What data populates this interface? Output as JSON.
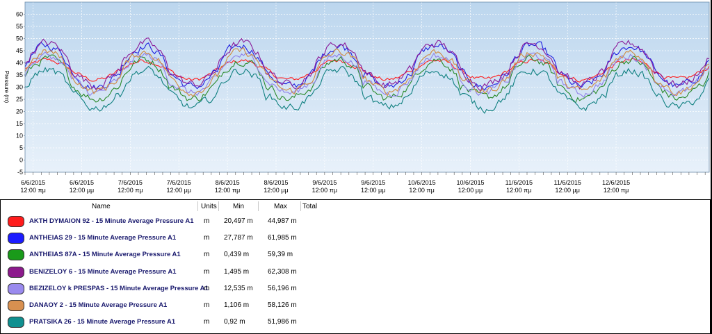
{
  "chart_data": {
    "type": "line",
    "ylabel": "Pressure (m)",
    "ylim": [
      -5,
      65
    ],
    "yticks": [
      -5,
      0,
      5,
      10,
      15,
      20,
      25,
      30,
      35,
      40,
      45,
      50,
      55,
      60
    ],
    "x_range": [
      "2015-06-05 22:00",
      "2015-06-12 23:00"
    ],
    "xtick_labels": [
      {
        "date": "6/6/2015",
        "time": "12:00 πμ"
      },
      {
        "date": "6/6/2015",
        "time": "12:00 μμ"
      },
      {
        "date": "7/6/2015",
        "time": "12:00 πμ"
      },
      {
        "date": "7/6/2015",
        "time": "12:00 μμ"
      },
      {
        "date": "8/6/2015",
        "time": "12:00 πμ"
      },
      {
        "date": "8/6/2015",
        "time": "12:00 μμ"
      },
      {
        "date": "9/6/2015",
        "time": "12:00 πμ"
      },
      {
        "date": "9/6/2015",
        "time": "12:00 μμ"
      },
      {
        "date": "10/6/2015",
        "time": "12:00 πμ"
      },
      {
        "date": "10/6/2015",
        "time": "12:00 μμ"
      },
      {
        "date": "11/6/2015",
        "time": "12:00 πμ"
      },
      {
        "date": "11/6/2015",
        "time": "12:00 μμ"
      },
      {
        "date": "12/6/2015",
        "time": "12:00 πμ"
      }
    ],
    "grid": true,
    "series": [
      {
        "name": "AKTH DYMAION 92 - 15 Minute Average Pressure A1",
        "color": "#ff2020",
        "base": 36,
        "amp": 5,
        "noise": 1.0
      },
      {
        "name": "ANTHEIAS 29 - 15 Minute Average Pressure A1",
        "color": "#2020e0",
        "base": 36,
        "amp": 22,
        "noise": 1.5
      },
      {
        "name": "ANTHEIAS 87A - 15 Minute Average Pressure A1",
        "color": "#2a8a2a",
        "base": 31,
        "amp": 21,
        "noise": 1.5
      },
      {
        "name": "BENIZELOY 6 - 15 Minute Average Pressure A1",
        "color": "#8a1a9a",
        "base": 37,
        "amp": 22,
        "noise": 1.5
      },
      {
        "name": "BEZIZELOY k PRESPAS - 15 Minute Average Pressure A1",
        "color": "#9080e8",
        "base": 33,
        "amp": 20,
        "noise": 1.4
      },
      {
        "name": "DANAOY 2 - 15 Minute Average Pressure A1",
        "color": "#d08a40",
        "base": 34,
        "amp": 21,
        "noise": 1.4
      },
      {
        "name": "PRATSIKA 26 - 15 Minute Average Pressure A1",
        "color": "#108080",
        "base": 27,
        "amp": 20,
        "noise": 1.5
      }
    ]
  },
  "legend": {
    "headers": {
      "name": "Name",
      "units": "Units",
      "min": "Min",
      "max": "Max",
      "total": "Total"
    },
    "rows": [
      {
        "name": "AKTH DYMAION 92 - 15 Minute Average Pressure A1",
        "units": "m",
        "min": "20,497 m",
        "max": "44,987 m",
        "color": "#ff1c1c"
      },
      {
        "name": "ANTHEIAS 29 - 15 Minute Average Pressure A1",
        "units": "m",
        "min": "27,787 m",
        "max": "61,985 m",
        "color": "#1c1cff"
      },
      {
        "name": "ANTHEIAS 87A - 15 Minute Average Pressure A1",
        "units": "m",
        "min": "0,439 m",
        "max": "59,39 m",
        "color": "#1a9a1a"
      },
      {
        "name": "BENIZELOY 6 - 15 Minute Average Pressure A1",
        "units": "m",
        "min": "1,495 m",
        "max": "62,308 m",
        "color": "#8c1a8c"
      },
      {
        "name": "BEZIZELOY k PRESPAS - 15 Minute Average Pressure A1",
        "units": "m",
        "min": "12,535 m",
        "max": "56,196 m",
        "color": "#9a8aee"
      },
      {
        "name": "DANAOY 2 - 15 Minute Average Pressure A1",
        "units": "m",
        "min": "1,106 m",
        "max": "58,126 m",
        "color": "#d89050"
      },
      {
        "name": "PRATSIKA 26 - 15 Minute Average Pressure A1",
        "units": "m",
        "min": "0,92 m",
        "max": "51,986 m",
        "color": "#109090"
      }
    ]
  }
}
